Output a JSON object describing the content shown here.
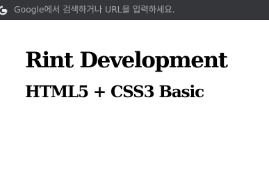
{
  "omnibox": {
    "placeholder": "Google에서 검색하거나 URL을 입력하세요.",
    "icon": "google-g-icon",
    "background": "#35363a"
  },
  "page": {
    "title": "Rint Development",
    "subtitle": "HTML5 + CSS3 Basic",
    "background": "#ffffff",
    "text_color": "#000000"
  }
}
